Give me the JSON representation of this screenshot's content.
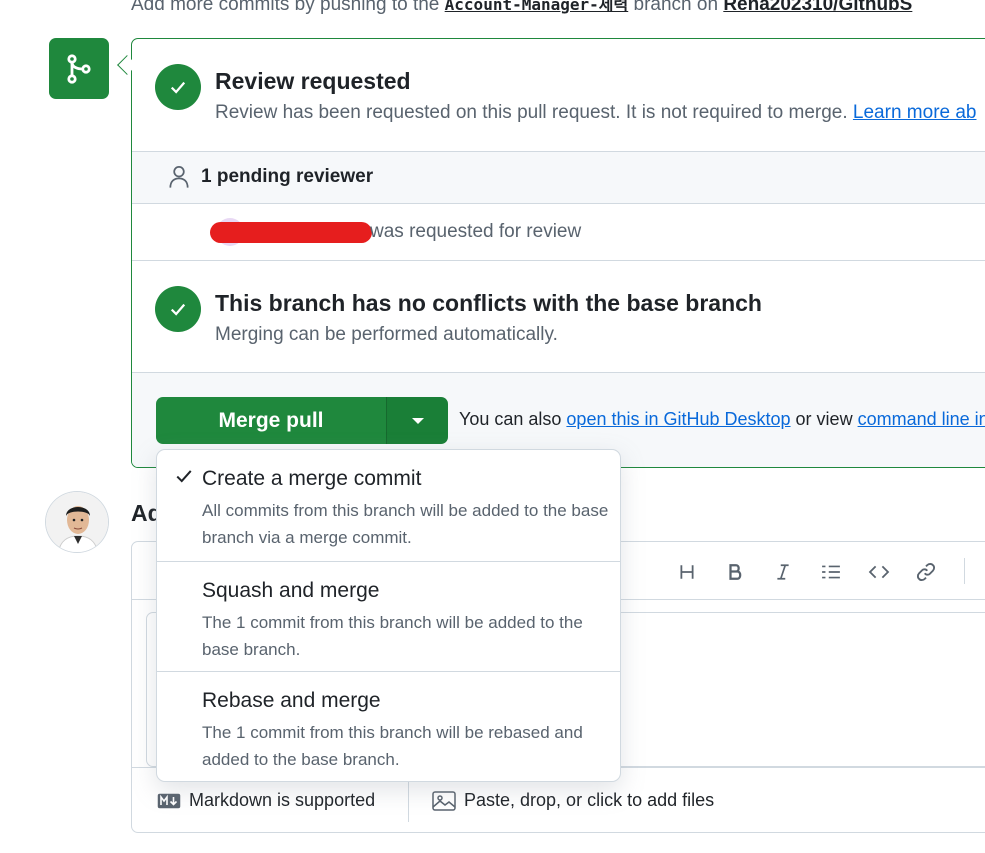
{
  "top_line": {
    "prefix": "Add more commits by pushing to the ",
    "branch": "Account-Manager-제력",
    "middle": " branch on ",
    "repo": "Rena202310/GithubS"
  },
  "review": {
    "title": "Review requested",
    "subtitle": "Review has been requested on this pull request. It is not required to merge.",
    "learn_more": "Learn more ab"
  },
  "pending": {
    "label": "1 pending reviewer",
    "reviewer_text": "was requested for review"
  },
  "conflicts": {
    "title": "This branch has no conflicts with the base branch",
    "subtitle": "Merging can be performed automatically."
  },
  "merge": {
    "button_label": "Merge pull request",
    "also_text": "You can also ",
    "desktop_link": "open this in GitHub Desktop",
    "or_view": " or view ",
    "cli_link": "command line in"
  },
  "add_comment": {
    "label": "Ad"
  },
  "dropdown": {
    "items": [
      {
        "title": "Create a merge commit",
        "description": "All commits from this branch will be added to the base branch via a merge commit.",
        "selected": true
      },
      {
        "title": "Squash and merge",
        "description": "The 1 commit from this branch will be added to the base branch.",
        "selected": false
      },
      {
        "title": "Rebase and merge",
        "description": "The 1 commit from this branch will be rebased and added to the base branch.",
        "selected": false
      }
    ]
  },
  "editor": {
    "toolbar_icons": [
      "heading-icon",
      "bold-icon",
      "italic-icon",
      "list-icon",
      "code-icon",
      "link-icon"
    ],
    "markdown_label": "Markdown is supported",
    "paste_label": "Paste, drop, or click to add files"
  },
  "colors": {
    "success_green": "#1f883d",
    "link_blue": "#0969da",
    "muted_text": "#59636e",
    "border": "#d1d9e0"
  }
}
